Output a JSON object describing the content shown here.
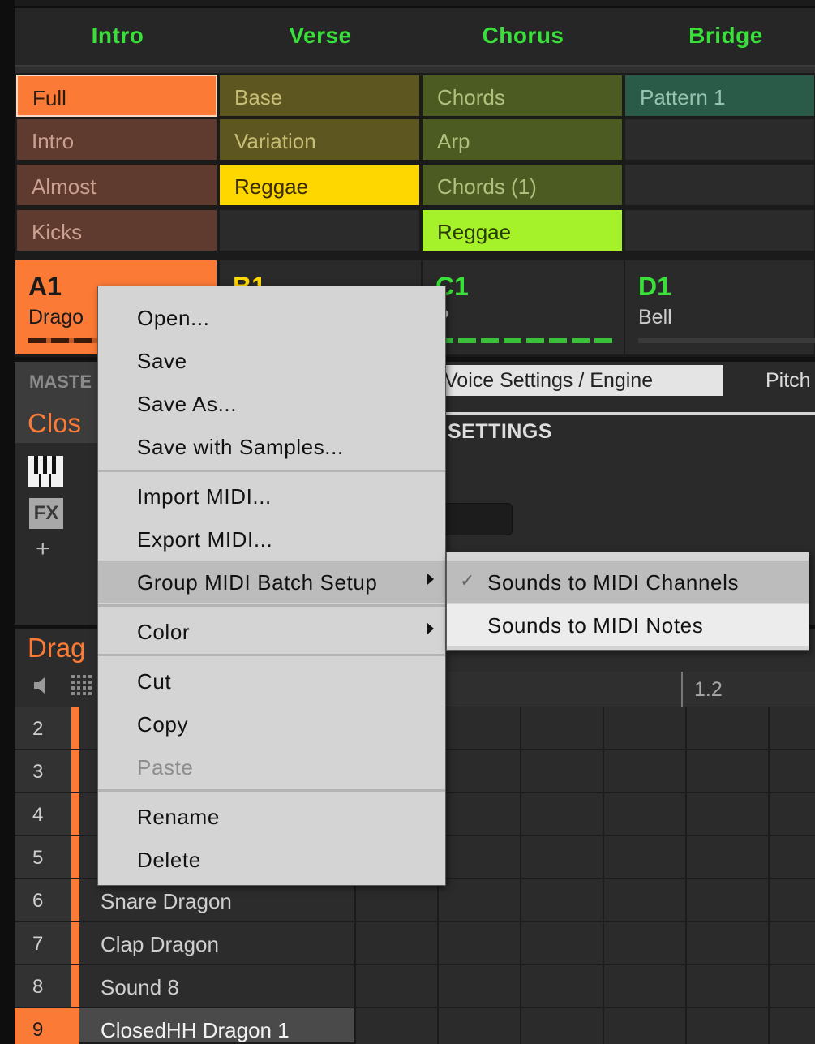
{
  "scenes": [
    "Intro",
    "Verse",
    "Chorus",
    "Bridge"
  ],
  "patterns": {
    "col_a": [
      "Full",
      "Intro",
      "Almost",
      "Kicks"
    ],
    "col_b": [
      "Base",
      "Variation",
      "Reggae",
      ""
    ],
    "col_c": [
      "Chords",
      "Arp",
      "Chords (1)",
      "Reggae"
    ],
    "col_d": [
      "Pattern 1",
      "",
      "",
      ""
    ]
  },
  "groups": [
    {
      "id": "A1",
      "name": "Drago",
      "color": "#fb7a36"
    },
    {
      "id": "B1",
      "name": "",
      "color": "#ffd700"
    },
    {
      "id": "C1",
      "name": "P",
      "color": "#39e03a"
    },
    {
      "id": "D1",
      "name": "Bell",
      "color": "#39e03a"
    }
  ],
  "master": {
    "label": "MASTE",
    "sound_title": "Clos"
  },
  "plugin_icons": {
    "keys": "piano-keys-icon",
    "fx": "FX",
    "add": "+"
  },
  "tabs": {
    "voice": "Voice Settings / Engine",
    "pitch": "Pitch"
  },
  "section": {
    "settings": "SETTINGS"
  },
  "pattern_editor": {
    "group_title": "Drag",
    "ruler_mark": "1.2"
  },
  "sounds": [
    {
      "num": "2",
      "name": ""
    },
    {
      "num": "3",
      "name": ""
    },
    {
      "num": "4",
      "name": ""
    },
    {
      "num": "5",
      "name": ""
    },
    {
      "num": "6",
      "name": "Snare Dragon"
    },
    {
      "num": "7",
      "name": "Clap Dragon"
    },
    {
      "num": "8",
      "name": "Sound 8"
    },
    {
      "num": "9",
      "name": "ClosedHH Dragon 1"
    }
  ],
  "context_menu": {
    "items": [
      "Open...",
      "Save",
      "Save As...",
      "Save with Samples...",
      "Import MIDI...",
      "Export MIDI...",
      "Group MIDI Batch Setup",
      "Color",
      "Cut",
      "Copy",
      "Paste",
      "Rename",
      "Delete"
    ],
    "disabled": [
      "Paste"
    ],
    "highlighted": "Group MIDI Batch Setup"
  },
  "submenu": {
    "items": [
      "Sounds to MIDI Channels",
      "Sounds to MIDI Notes"
    ],
    "checked": "Sounds to MIDI Channels",
    "check_glyph": "✓"
  },
  "colors": {
    "accent_orange": "#fb7a36",
    "scene_green": "#39e03a",
    "yellow": "#ffd700",
    "lime": "#a5f12a"
  }
}
